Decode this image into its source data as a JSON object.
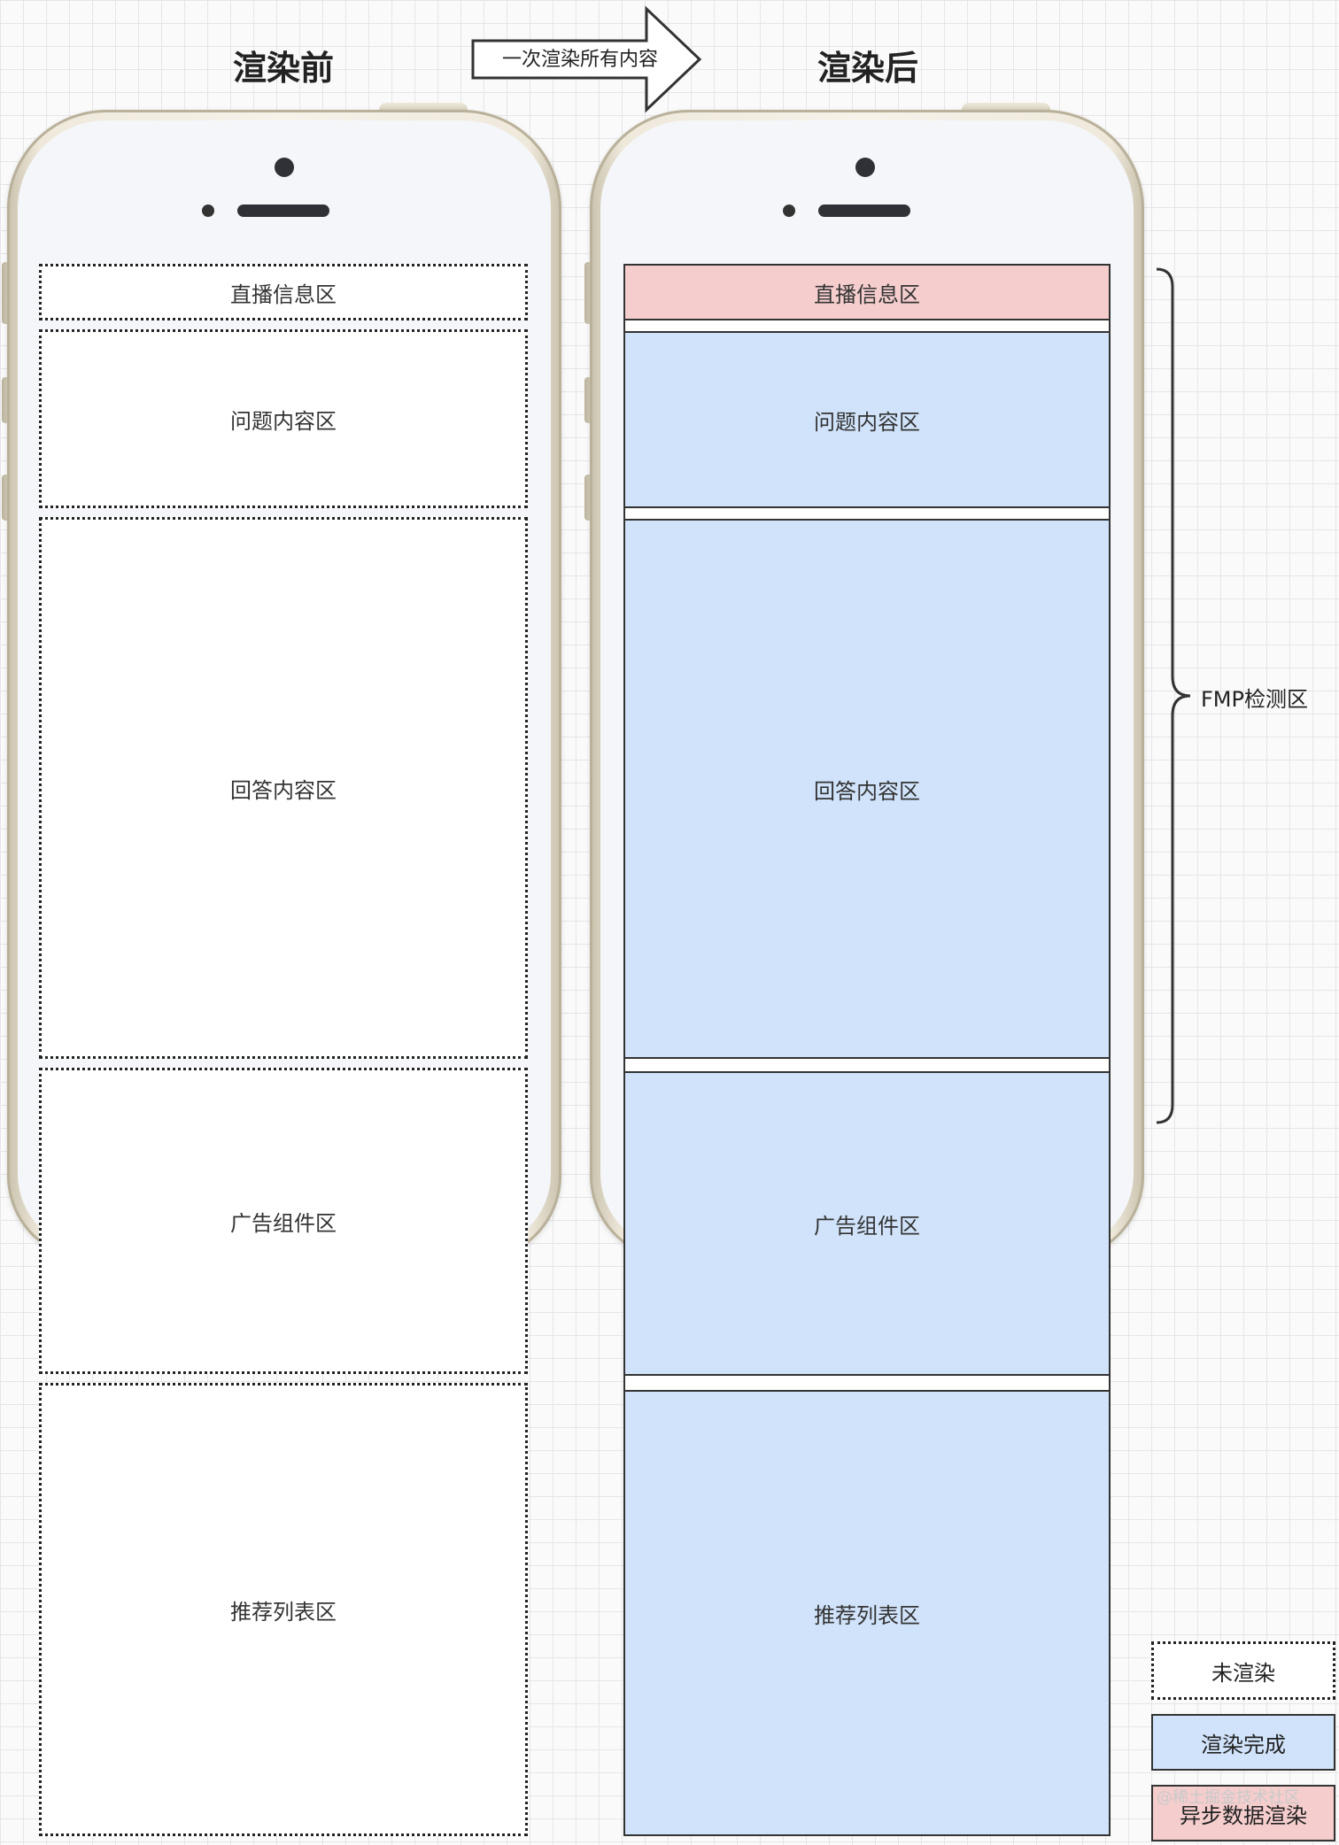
{
  "titles": {
    "before": "渲染前",
    "after": "渲染后",
    "arrow": "一次渲染所有内容"
  },
  "sections": {
    "live_info": "直播信息区",
    "question": "问题内容区",
    "answer": "回答内容区",
    "ad": "广告组件区",
    "recommend": "推荐列表区"
  },
  "brace_label": "FMP检测区",
  "legend": {
    "not_rendered": "未渲染",
    "rendered": "渲染完成",
    "async_rendered": "异步数据渲染"
  },
  "watermark": "@稀土掘金技术社区",
  "colors": {
    "rendered": "#d0e3fa",
    "async": "#f5cdcd",
    "grid": "#e6e6e6"
  }
}
